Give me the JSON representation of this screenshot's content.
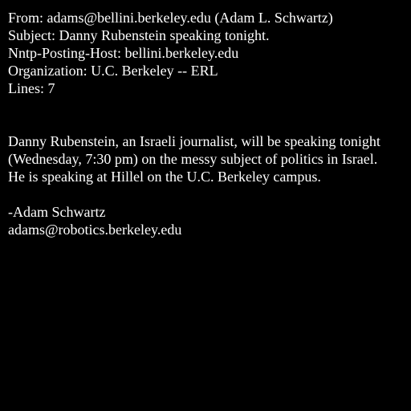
{
  "message": {
    "headers": [
      "From: adams@bellini.berkeley.edu (Adam L. Schwartz)",
      "Subject: Danny Rubenstein speaking tonight.",
      "Nntp-Posting-Host: bellini.berkeley.edu",
      "Organization: U.C. Berkeley -- ERL",
      "Lines: 7"
    ],
    "body": [
      "Danny Rubenstein, an Israeli journalist, will be speaking tonight",
      "(Wednesday, 7:30 pm) on the messy subject of politics in Israel.",
      "He is speaking at Hillel on the U.C. Berkeley campus."
    ],
    "signature": [
      "-Adam Schwartz",
      "adams@robotics.berkeley.edu"
    ]
  },
  "colors": {
    "background": "#000000",
    "text": "#ffffff"
  }
}
